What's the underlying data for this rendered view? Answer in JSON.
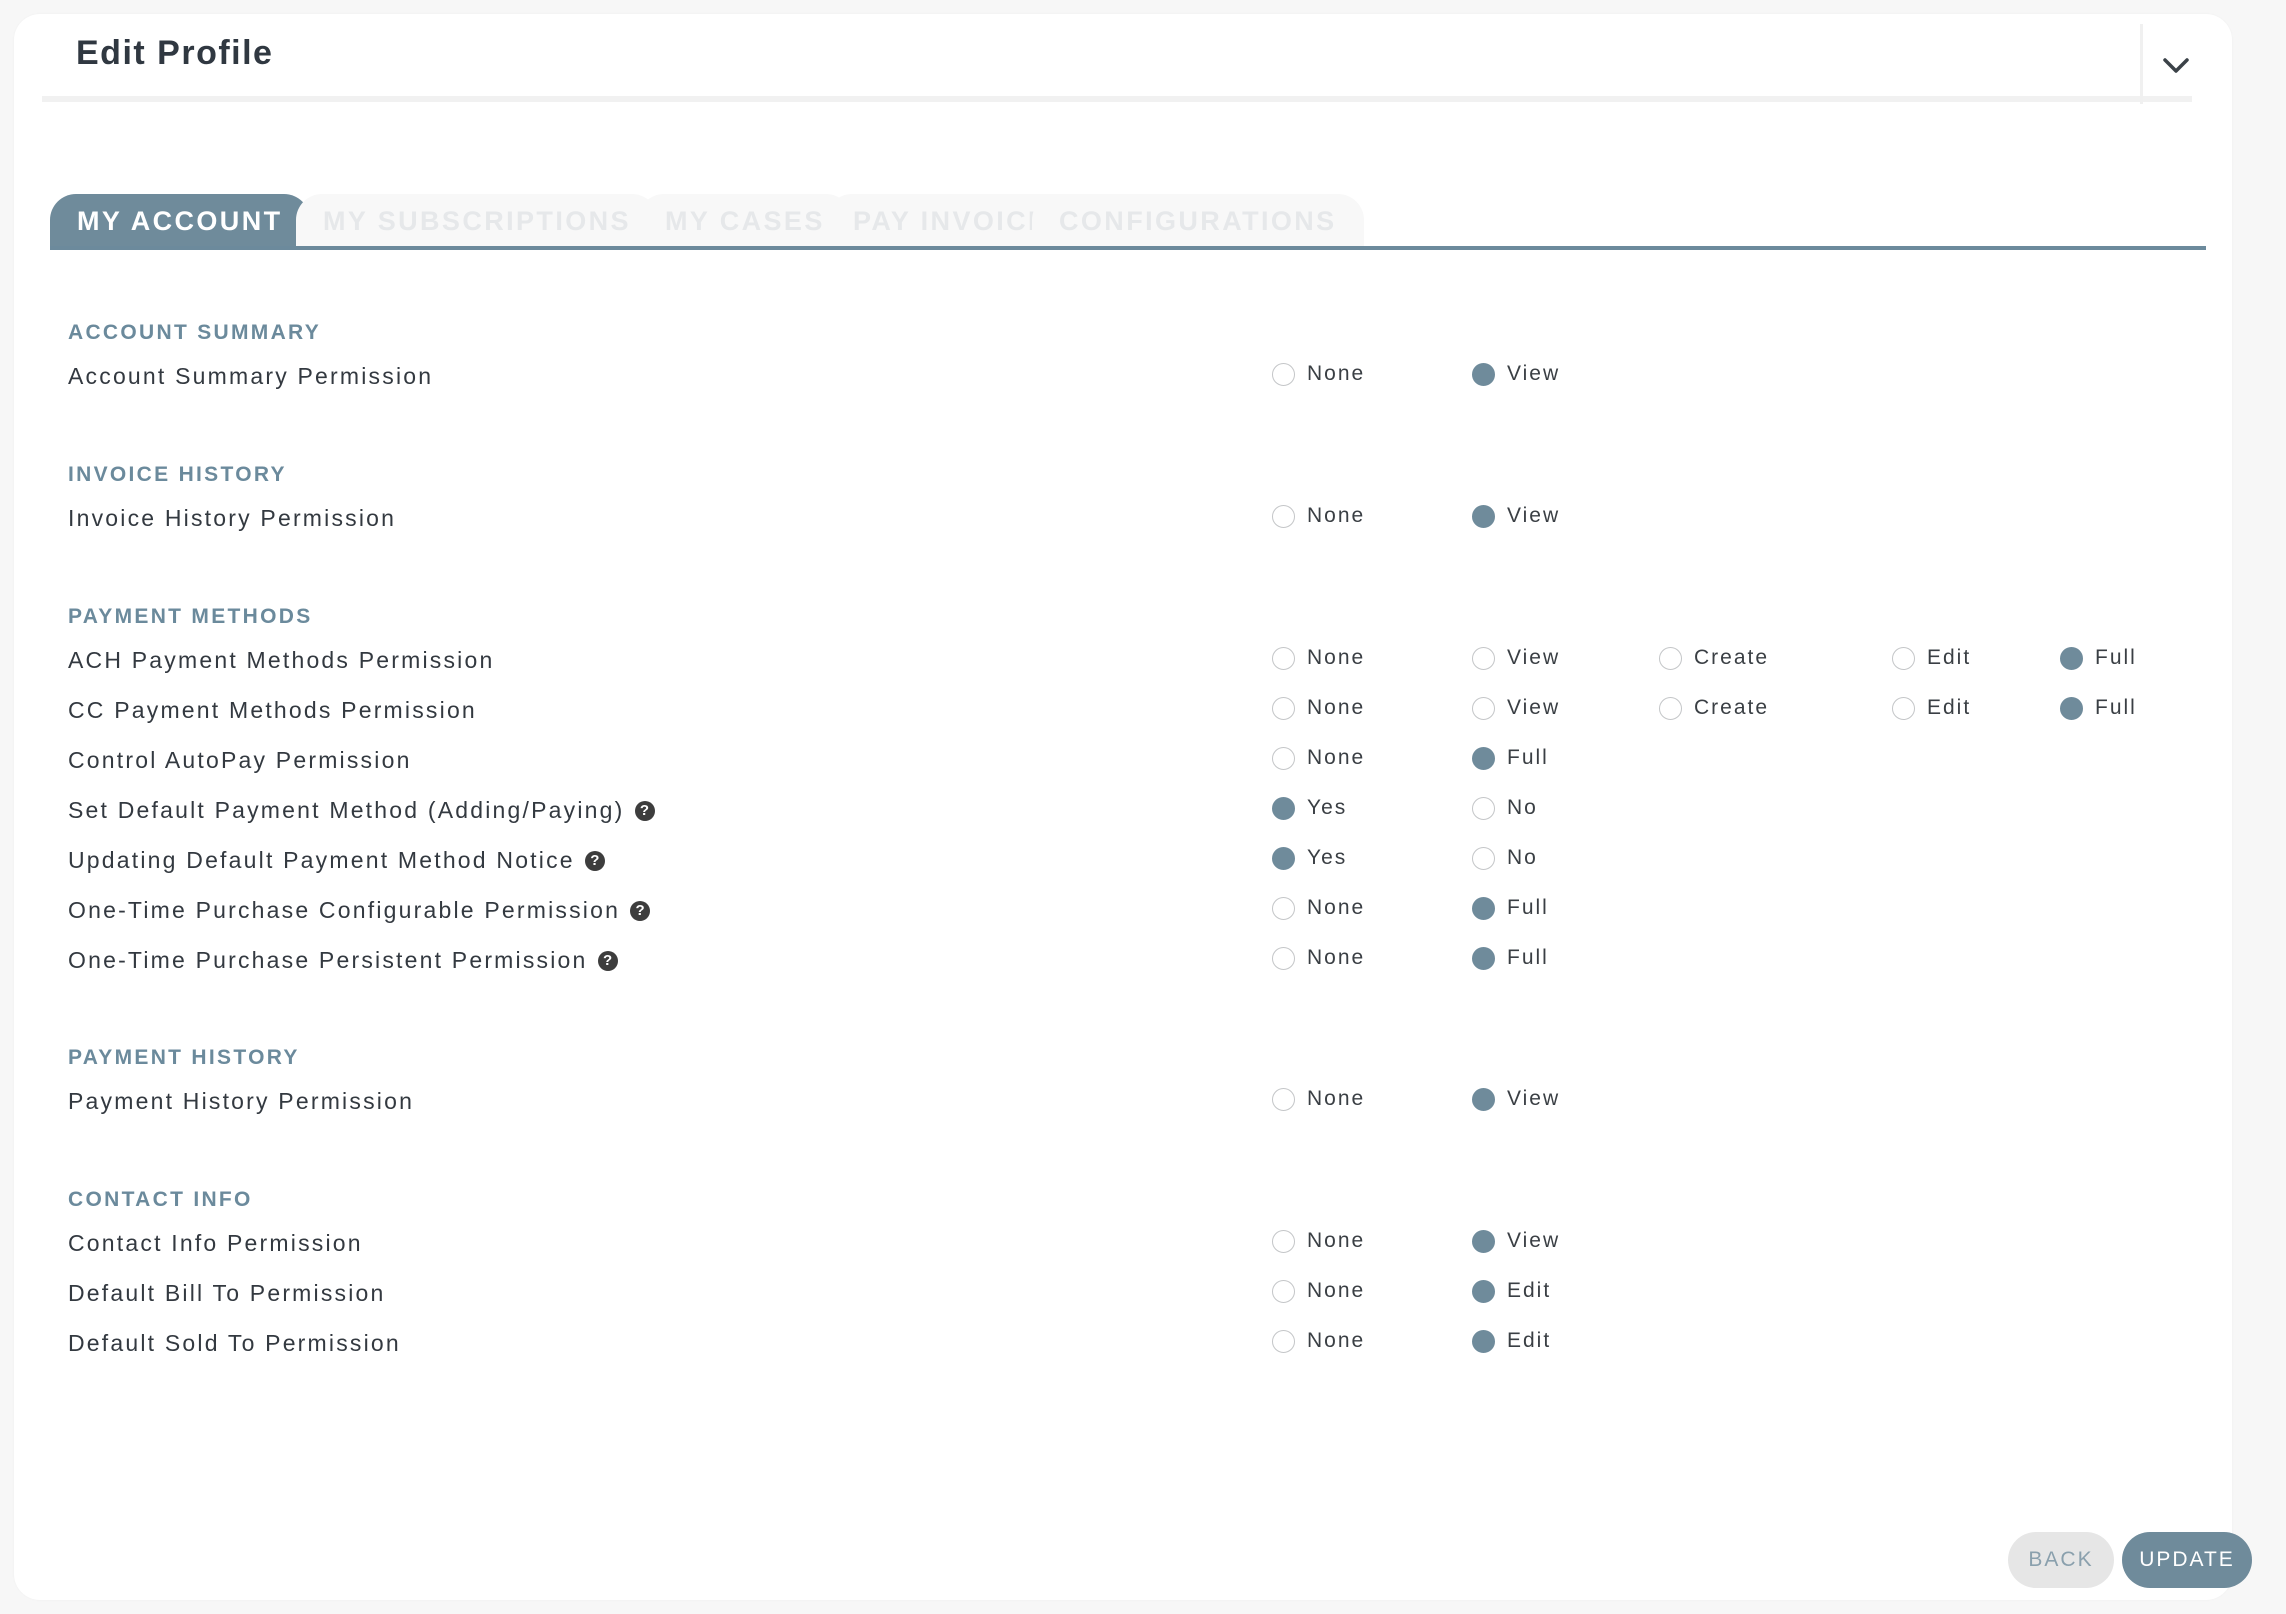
{
  "header": {
    "title": "Edit Profile",
    "collapse_icon": "chevron-down-icon"
  },
  "tabs": [
    {
      "label": "MY ACCOUNT",
      "active": true
    },
    {
      "label": "MY SUBSCRIPTIONS",
      "active": false
    },
    {
      "label": "MY CASES",
      "active": false
    },
    {
      "label": "PAY INVOICES",
      "active": false
    },
    {
      "label": "CONFIGURATIONS",
      "active": false
    }
  ],
  "sections": [
    {
      "title": "ACCOUNT SUMMARY",
      "rows": [
        {
          "label": "Account Summary Permission",
          "help": false,
          "options": [
            "None",
            "View"
          ],
          "selected": "View"
        }
      ]
    },
    {
      "title": "INVOICE HISTORY",
      "rows": [
        {
          "label": "Invoice History Permission",
          "help": false,
          "options": [
            "None",
            "View"
          ],
          "selected": "View"
        }
      ]
    },
    {
      "title": "PAYMENT METHODS",
      "rows": [
        {
          "label": "ACH Payment Methods Permission",
          "help": false,
          "options": [
            "None",
            "View",
            "Create",
            "Edit",
            "Full"
          ],
          "selected": "Full"
        },
        {
          "label": "CC Payment Methods Permission",
          "help": false,
          "options": [
            "None",
            "View",
            "Create",
            "Edit",
            "Full"
          ],
          "selected": "Full"
        },
        {
          "label": "Control AutoPay Permission",
          "help": false,
          "options": [
            "None",
            "Full"
          ],
          "selected": "Full"
        },
        {
          "label": "Set Default Payment Method (Adding/Paying)",
          "help": true,
          "options": [
            "Yes",
            "No"
          ],
          "selected": "Yes"
        },
        {
          "label": "Updating Default Payment Method Notice",
          "help": true,
          "options": [
            "Yes",
            "No"
          ],
          "selected": "Yes"
        },
        {
          "label": "One-Time Purchase Configurable Permission",
          "help": true,
          "options": [
            "None",
            "Full"
          ],
          "selected": "Full"
        },
        {
          "label": "One-Time Purchase Persistent Permission",
          "help": true,
          "options": [
            "None",
            "Full"
          ],
          "selected": "Full"
        }
      ]
    },
    {
      "title": "PAYMENT HISTORY",
      "rows": [
        {
          "label": "Payment History Permission",
          "help": false,
          "options": [
            "None",
            "View"
          ],
          "selected": "View"
        }
      ]
    },
    {
      "title": "CONTACT INFO",
      "rows": [
        {
          "label": "Contact Info Permission",
          "help": false,
          "options": [
            "None",
            "View"
          ],
          "selected": "View"
        },
        {
          "label": "Default Bill To Permission",
          "help": false,
          "options": [
            "None",
            "Edit"
          ],
          "selected": "Edit"
        },
        {
          "label": "Default Sold To Permission",
          "help": false,
          "options": [
            "None",
            "Edit"
          ],
          "selected": "Edit"
        }
      ]
    }
  ],
  "help_glyph": "?",
  "help_icon": "question-circle-icon",
  "footer": {
    "back_label": "BACK",
    "update_label": "UPDATE"
  },
  "colors": {
    "accent": "#6f8b9b",
    "section_title": "#6b8a9c",
    "back_button_bg": "#e6e6e6"
  }
}
